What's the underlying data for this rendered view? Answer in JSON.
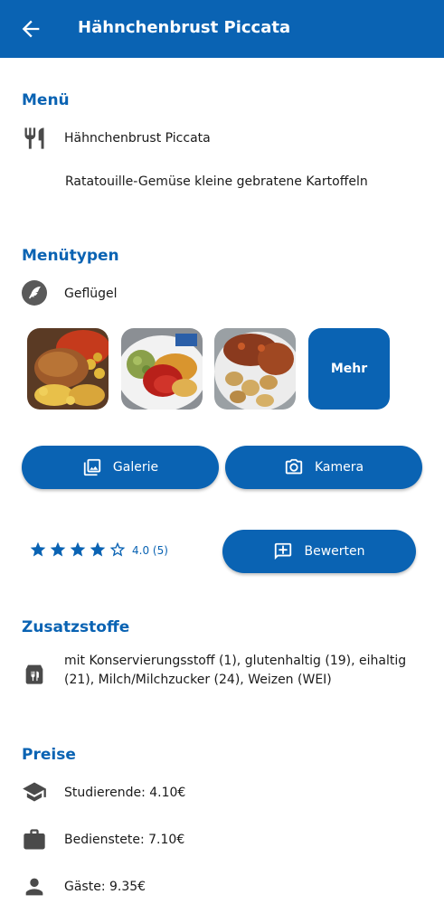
{
  "appbar": {
    "title": "Hähnchenbrust Piccata"
  },
  "menu": {
    "heading": "Menü",
    "name": "Hähnchenbrust Piccata",
    "sides": "Ratatouille-Gemüse kleine gebratene Kartoffeln"
  },
  "menutypes": {
    "heading": "Menütypen",
    "type": "Geflügel",
    "more_label": "Mehr"
  },
  "buttons": {
    "gallery_label": "Galerie",
    "camera_label": "Kamera",
    "rate_label": "Bewerten"
  },
  "rating": {
    "value": 4.0,
    "text": "4.0 (5)",
    "count": 5,
    "max": 5
  },
  "additives": {
    "heading": "Zusatzstoffe",
    "text": "mit Konservierungsstoff (1), glutenhaltig (19), eihaltig (21), Milch/Milchzucker (24), Weizen (WEI)"
  },
  "prices": {
    "heading": "Preise",
    "students": "Studierende: 4.10€",
    "staff": "Bedienstete: 7.10€",
    "guests": "Gäste: 9.35€"
  },
  "colors": {
    "primary": "#0a63b3",
    "icon_gray": "#4a4a4a"
  },
  "icons": [
    "back-arrow-icon",
    "cutlery-icon",
    "feather-icon",
    "gallery-icon",
    "camera-icon",
    "star-icon",
    "add-comment-icon",
    "food-allergen-icon",
    "graduation-cap-icon",
    "briefcase-icon",
    "person-icon"
  ]
}
